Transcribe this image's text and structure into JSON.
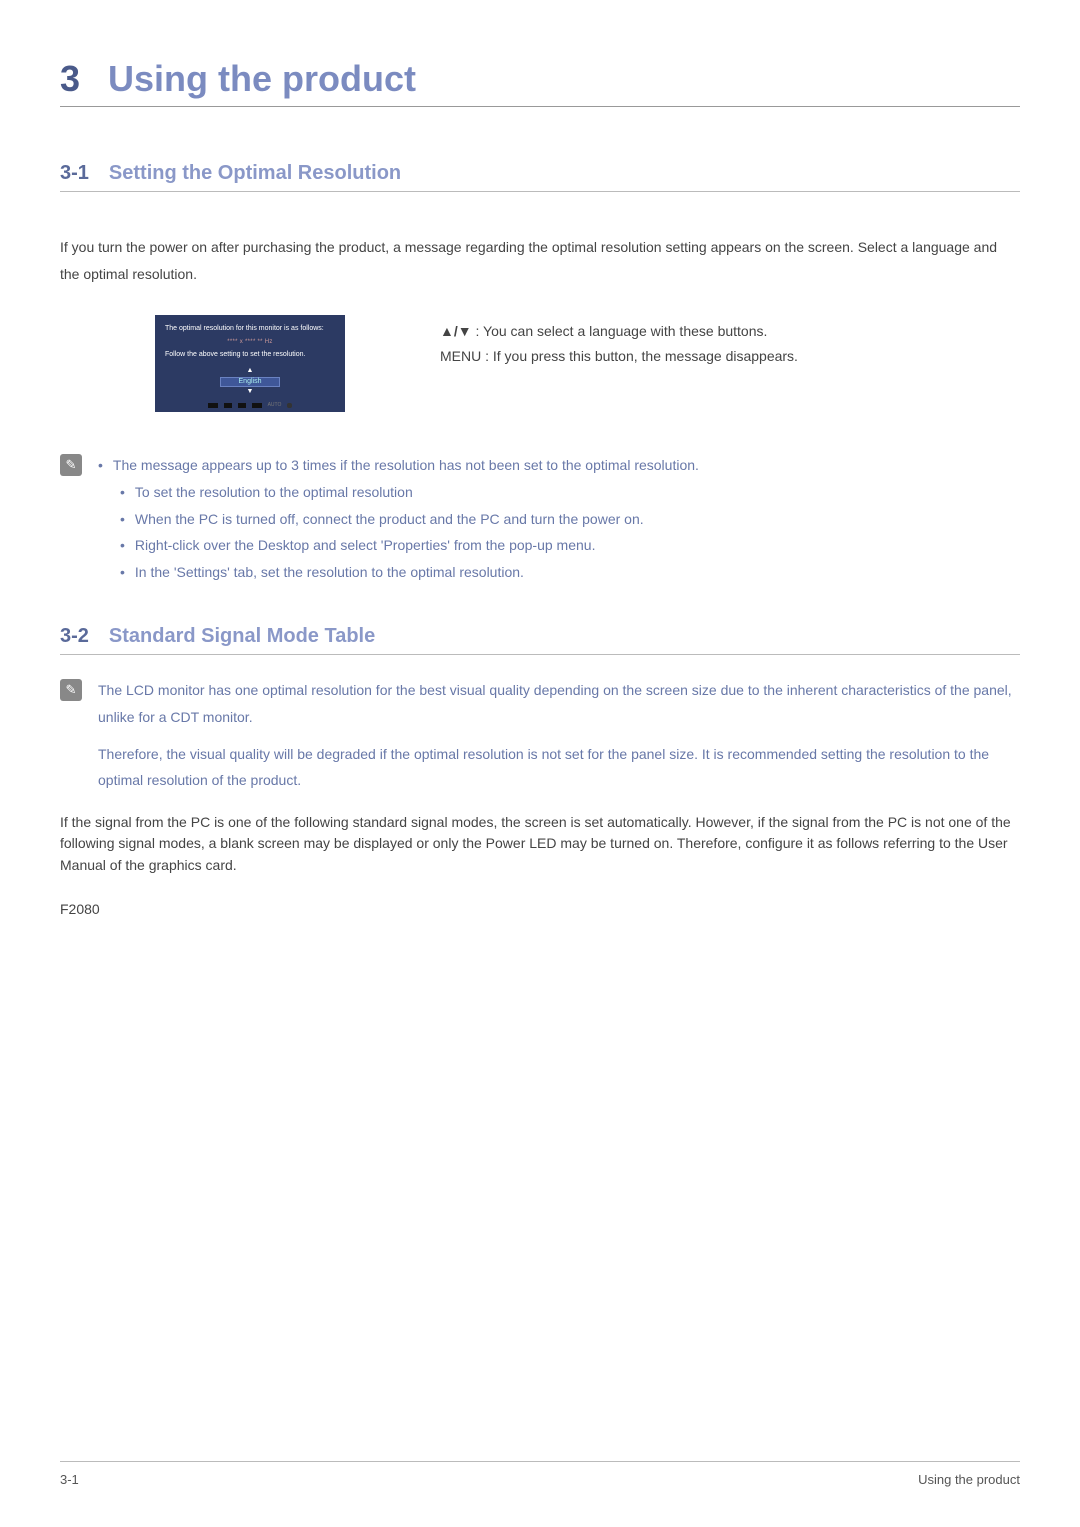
{
  "chapter": {
    "num": "3",
    "title": "Using the product"
  },
  "sec1": {
    "num": "3-1",
    "title": "Setting the Optimal Resolution",
    "intro": "If you turn the power on after purchasing the product, a message regarding the optimal resolution setting appears on the screen. Select a language and the optimal resolution.",
    "osd": {
      "line1": "The optimal resolution for this monitor is as follows:",
      "mid": "**** x **** ** Hz",
      "line2": "Follow the above setting to set the resolution.",
      "lang_up": "▲",
      "lang_sel": "English",
      "lang_down": "▼",
      "auto": "AUTO"
    },
    "btninfo": {
      "arrows": "▲/▼",
      "arrows_desc": " : You can select a language with these buttons.",
      "menu": "MENU : If you press this button, the message disappears."
    },
    "note": {
      "b0": "The message appears up to 3 times if the resolution has not been set to the optimal resolution.",
      "b1": "To set the resolution to the optimal resolution",
      "b2": "When the PC is turned off, connect the product and the PC and turn the power on.",
      "b3": "Right-click over the Desktop and select 'Properties' from the pop-up menu.",
      "b4": "In the 'Settings' tab, set the resolution to the optimal resolution."
    }
  },
  "sec2": {
    "num": "3-2",
    "title": "Standard Signal Mode Table",
    "note": {
      "p1": "The LCD monitor has one optimal resolution for the best visual quality depending on the screen size due to the inherent characteristics of the panel, unlike for a CDT monitor.",
      "p2": "Therefore, the visual quality will be degraded if the optimal resolution is not set for the panel size. It is recommended setting the resolution to the optimal resolution of the product."
    },
    "body": "If the signal from the PC is one of the following standard signal modes, the screen is set automatically. However, if the signal from the PC is not one of the following signal modes, a blank screen may be displayed or only the Power LED may be turned on. Therefore, configure it as follows referring to the User Manual of the graphics card.",
    "model": "F2080"
  },
  "footer": {
    "left": "3-1",
    "right": "Using the product"
  }
}
